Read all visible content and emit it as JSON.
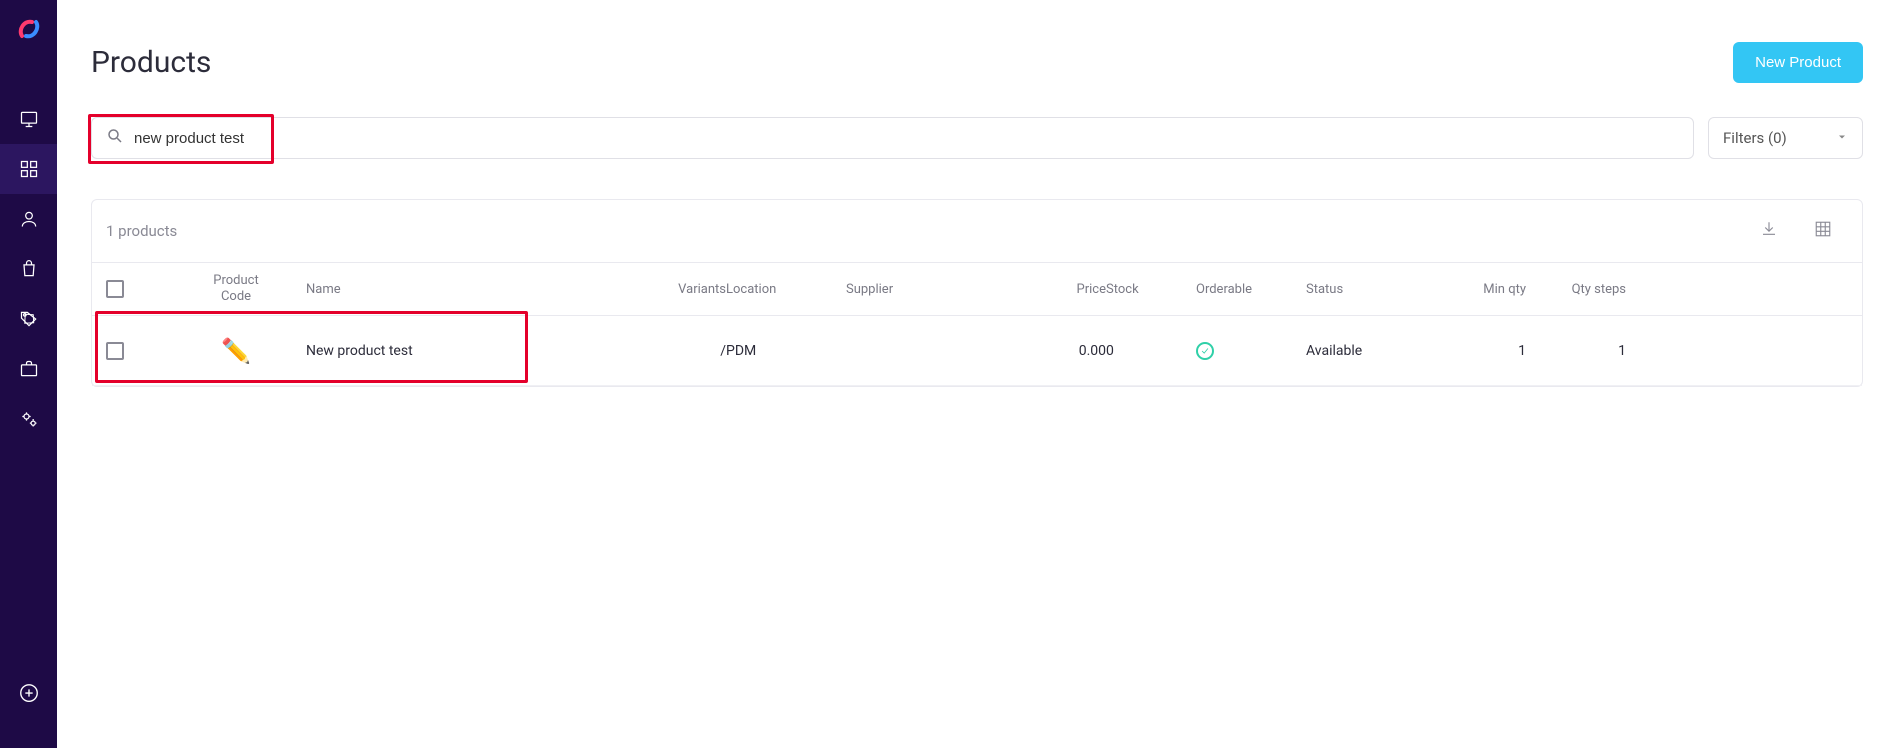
{
  "page": {
    "title": "Products"
  },
  "header": {
    "new_button": "New Product"
  },
  "search": {
    "value": "new product test"
  },
  "filters": {
    "label": "Filters (0)"
  },
  "table": {
    "count_label": "1 products",
    "headers": {
      "product_code": "Product Code",
      "name": "Name",
      "variants": "Variants",
      "location": "Location",
      "supplier": "Supplier",
      "price": "Price",
      "stock": "Stock",
      "orderable": "Orderable",
      "status": "Status",
      "min_qty": "Min qty",
      "qty_steps": "Qty steps"
    },
    "rows": [
      {
        "product_code": "",
        "name": "New product test",
        "variants": "/",
        "location": "PDM",
        "supplier": "",
        "price": "0.00",
        "stock": "0",
        "orderable": true,
        "status": "Available",
        "min_qty": "1",
        "qty_steps": "1"
      }
    ]
  }
}
